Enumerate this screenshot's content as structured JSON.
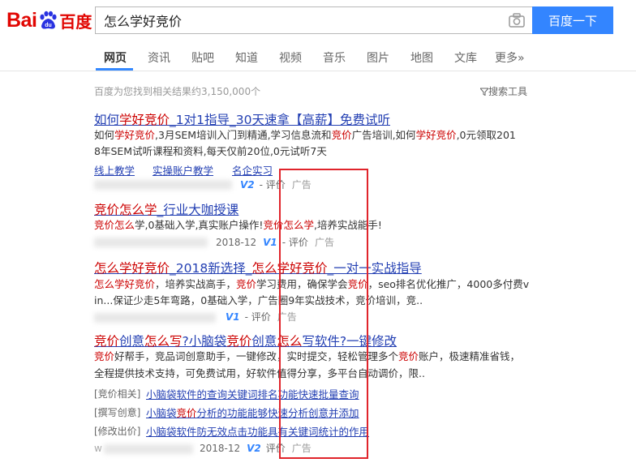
{
  "logo": {
    "text_bai": "Bai",
    "paw_text": "du",
    "text_cn": "百度"
  },
  "search": {
    "query": "怎么学好竞价",
    "button": "百度一下",
    "camera_icon": "camera-icon"
  },
  "tabs": [
    {
      "label": "网页",
      "active": true
    },
    {
      "label": "资讯"
    },
    {
      "label": "贴吧"
    },
    {
      "label": "知道"
    },
    {
      "label": "视频"
    },
    {
      "label": "音乐"
    },
    {
      "label": "图片"
    },
    {
      "label": "地图"
    },
    {
      "label": "文库"
    },
    {
      "label": "更多»"
    }
  ],
  "meta": {
    "count": "百度为您找到相关结果约3,150,000个",
    "tools": "搜索工具"
  },
  "results": [
    {
      "title": [
        "如何",
        "学好竞价",
        "_1对1指导_30天速拿【高薪】免费试听"
      ],
      "desc1": [
        "如何",
        "学好竞价",
        ",3月SEM培训入门到精通,学习信息流和",
        "竞价",
        "广告培训,如何",
        "学好竞价",
        ",0元领取201"
      ],
      "desc2": "8年SEM试听课程和资料,每天仅前20位,0元试听7天",
      "links": [
        "线上教学",
        "实操账户教学",
        "名企实习"
      ],
      "foot": {
        "v": "V2",
        "ping": "- 评价",
        "ad": "广告"
      }
    },
    {
      "title": [
        "竞价怎么学",
        "_行业大咖授课"
      ],
      "desc1": [
        "竞价怎么",
        "学,0基础入学,真实账户操作!",
        "竞价怎么学",
        ",培养实战能手!"
      ],
      "foot": {
        "date": "2018-12",
        "v": "V1",
        "ping": "- 评价",
        "ad": "广告"
      }
    },
    {
      "title": [
        "怎么学好竞价",
        "_2018新选择_",
        "怎么学好竞价",
        "_一对一实战指导"
      ],
      "desc1": [
        "怎么学好竞价",
        "，培养实战高手，",
        "竞价",
        "学习费用，确保学会",
        "竞价",
        "，seo排名优化推广，4000多付费v"
      ],
      "desc2": "in...保证少走5年弯路，0基础入学，广告圈9年实战技术，竞价培训，竞..",
      "foot": {
        "v": "V1",
        "ping": "- 评价",
        "ad": "广告"
      }
    },
    {
      "title": [
        "竞价",
        "创意",
        "怎么写",
        "?小脑袋",
        "竞价",
        "创意",
        "怎么",
        "写软件?一键修改"
      ],
      "desc1": [
        "竞价",
        "好帮手，竞品词创意助手，一键修改，实时提交，轻松管理多个",
        "竞价",
        "账户，极速精准省钱，"
      ],
      "desc2": "全程提供技术支持，可免费试用，好软件值得分享，多平台自动调价，限..",
      "subs": [
        {
          "label": "[竞价相关]",
          "link": "小脑袋软件的查询关键词排名功能快速批量查询"
        },
        {
          "label": "[撰写创意]",
          "link_parts": [
            "小脑袋",
            "竞价",
            "分析的功能能够快速分析创意并添加"
          ]
        },
        {
          "label": "[修改出价]",
          "link": "小脑袋软件防无效点击功能具有关键词统计的作用"
        }
      ],
      "foot": {
        "w": "w",
        "date": "2018-12",
        "v": "V2",
        "ping": "评价",
        "ad": "广告"
      }
    }
  ],
  "colors": {
    "brand_red": "#e10602",
    "link_blue": "#2440b3",
    "highlight": "#c00",
    "button_blue": "#3385ff",
    "box_red": "#e0242b"
  }
}
